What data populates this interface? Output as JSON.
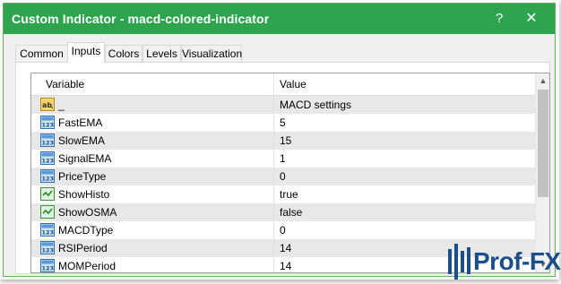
{
  "window": {
    "title": "Custom Indicator - macd-colored-indicator",
    "help_label": "?",
    "close_label": "✕"
  },
  "tabs": [
    {
      "label": "Common",
      "active": false
    },
    {
      "label": "Inputs",
      "active": true
    },
    {
      "label": "Colors",
      "active": false
    },
    {
      "label": "Levels",
      "active": false
    },
    {
      "label": "Visualization",
      "active": false
    }
  ],
  "grid": {
    "headers": {
      "variable": "Variable",
      "value": "Value"
    },
    "rows": [
      {
        "icon": "ab-string-icon",
        "variable": "_",
        "value": "MACD settings"
      },
      {
        "icon": "int-123-icon",
        "variable": "FastEMA",
        "value": "5"
      },
      {
        "icon": "int-123-icon",
        "variable": "SlowEMA",
        "value": "15"
      },
      {
        "icon": "int-123-icon",
        "variable": "SignalEMA",
        "value": "1"
      },
      {
        "icon": "int-123-icon",
        "variable": "PriceType",
        "value": "0"
      },
      {
        "icon": "bool-check-icon",
        "variable": "ShowHisto",
        "value": "true"
      },
      {
        "icon": "bool-check-icon",
        "variable": "ShowOSMA",
        "value": "false"
      },
      {
        "icon": "int-123-icon",
        "variable": "MACDType",
        "value": "0"
      },
      {
        "icon": "int-123-icon",
        "variable": "RSIPeriod",
        "value": "14"
      },
      {
        "icon": "int-123-icon",
        "variable": "MOMPeriod",
        "value": "14"
      }
    ]
  },
  "scrollbar": {
    "up_label": "▲",
    "down_label": "▼"
  },
  "watermark": {
    "text": "Prof-FX",
    "icon": "logo-icon"
  },
  "colors": {
    "titlebar": "#2ea44f",
    "logo": "#1b4f8a"
  }
}
